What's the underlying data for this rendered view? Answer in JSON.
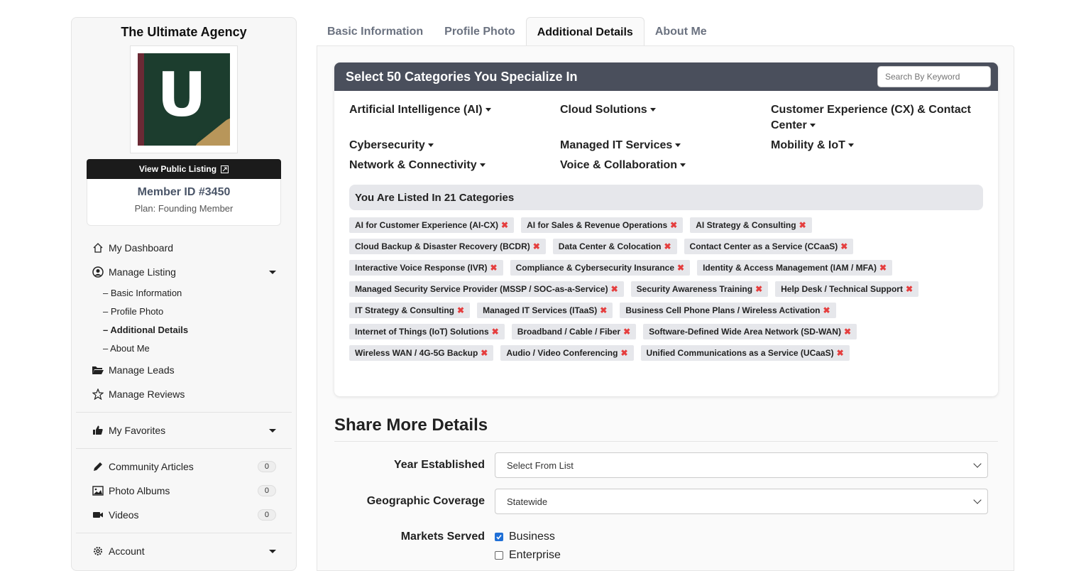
{
  "sidebar": {
    "agency_name": "The Ultimate Agency",
    "logo_letter": "U",
    "view_public_label": "View Public Listing",
    "member_id": "Member ID #3450",
    "plan": "Plan: Founding Member",
    "nav": {
      "dashboard": "My Dashboard",
      "manage_listing": "Manage Listing",
      "sub": [
        "– Basic Information",
        "– Profile Photo",
        "– Additional Details",
        "– About Me"
      ],
      "manage_leads": "Manage Leads",
      "manage_reviews": "Manage Reviews",
      "favorites": "My Favorites",
      "articles": "Community Articles",
      "articles_count": "0",
      "albums": "Photo Albums",
      "albums_count": "0",
      "videos": "Videos",
      "videos_count": "0",
      "account": "Account"
    }
  },
  "tabs": [
    "Basic Information",
    "Profile Photo",
    "Additional Details",
    "About Me"
  ],
  "categories": {
    "title": "Select 50 Categories You Specialize In",
    "search_placeholder": "Search By Keyword",
    "groups": [
      "Artificial Intelligence (AI)",
      "Cloud Solutions",
      "Customer Experience (CX) & Contact Center",
      "Cybersecurity",
      "Managed IT Services",
      "Mobility & IoT",
      "Network & Connectivity",
      "Voice & Collaboration"
    ],
    "listed_title": "You Are Listed In 21 Categories",
    "listed": [
      "AI for Customer Experience (AI-CX)",
      "AI for Sales & Revenue Operations",
      "AI Strategy & Consulting",
      "Cloud Backup & Disaster Recovery (BCDR)",
      "Data Center & Colocation",
      "Contact Center as a Service (CCaaS)",
      "Interactive Voice Response (IVR)",
      "Compliance & Cybersecurity Insurance",
      "Identity & Access Management (IAM / MFA)",
      "Managed Security Service Provider (MSSP / SOC-as-a-Service)",
      "Security Awareness Training",
      "Help Desk / Technical Support",
      "IT Strategy & Consulting",
      "Managed IT Services (ITaaS)",
      "Business Cell Phone Plans / Wireless Activation",
      "Internet of Things (IoT) Solutions",
      "Broadband / Cable / Fiber",
      "Software-Defined Wide Area Network (SD-WAN)",
      "Wireless WAN / 4G-5G Backup",
      "Audio / Video Conferencing",
      "Unified Communications as a Service (UCaaS)"
    ]
  },
  "share": {
    "title": "Share More Details",
    "year_label": "Year Established",
    "year_value": "Select From List",
    "coverage_label": "Geographic Coverage",
    "coverage_value": "Statewide",
    "markets_label": "Markets Served",
    "markets": [
      {
        "label": "Business",
        "checked": true
      },
      {
        "label": "Enterprise",
        "checked": false
      }
    ]
  },
  "colors": {
    "header_bg": "#4a4f5c",
    "logo_green": "#1c3d2e",
    "logo_maroon": "#6b2a35",
    "logo_gold": "#b8965a",
    "remove_x": "#e53e3e",
    "checkbox": "#1f6fd6"
  }
}
